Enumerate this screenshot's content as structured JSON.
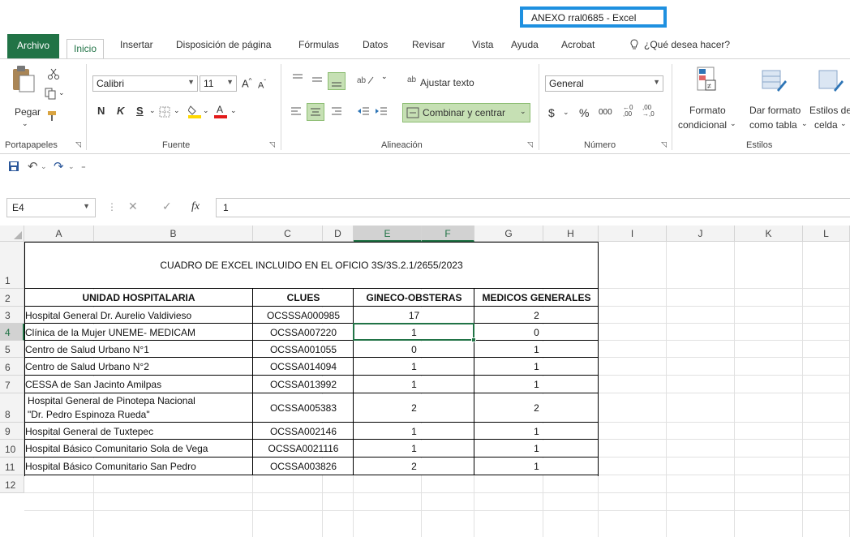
{
  "window": {
    "title": "ANEXO rral0685  -  Excel"
  },
  "tabs": [
    "Archivo",
    "Inicio",
    "Insertar",
    "Disposición de página",
    "Fórmulas",
    "Datos",
    "Revisar",
    "Vista",
    "Ayuda",
    "Acrobat"
  ],
  "tell_me": "¿Qué desea hacer?",
  "ribbon": {
    "clipboard": {
      "paste": "Pegar",
      "label": "Portapapeles"
    },
    "font": {
      "name": "Calibri",
      "size": "11",
      "bold": "N",
      "italic": "K",
      "underline": "S",
      "label": "Fuente"
    },
    "alignment": {
      "wrap": "Ajustar texto",
      "merge": "Combinar y centrar",
      "label": "Alineación"
    },
    "number": {
      "format": "General",
      "currency": "$",
      "percent": "%",
      "thousands": "000",
      "label": "Número"
    },
    "styles": {
      "conditional": [
        "Formato",
        "condicional"
      ],
      "as_table": [
        "Dar formato",
        "como tabla"
      ],
      "cell_styles": [
        "Estilos de",
        "celda"
      ],
      "label": "Estilos"
    }
  },
  "formula_bar": {
    "name_box": "E4",
    "fx": "fx",
    "value": "1"
  },
  "columns": [
    "A",
    "B",
    "C",
    "D",
    "E",
    "F",
    "G",
    "H",
    "I",
    "J",
    "K",
    "L"
  ],
  "rows": [
    "1",
    "2",
    "3",
    "4",
    "5",
    "6",
    "7",
    "8",
    "9",
    "10",
    "11",
    "12"
  ],
  "sheet": {
    "title": "CUADRO DE EXCEL INCLUIDO EN EL OFICIO 3S/3S.2.1/2655/2023",
    "headers": [
      "UNIDAD HOSPITALARIA",
      "CLUES",
      "GINECO-OBSTERAS",
      "MEDICOS GENERALES"
    ],
    "rows": [
      {
        "unidad": "Hospital General Dr. Aurelio Valdivieso",
        "clues": "OCSSSA000985",
        "gineco": "17",
        "medicos": "2"
      },
      {
        "unidad": "Clínica de la Mujer UNEME- MEDICAM",
        "clues": "OCSSA007220",
        "gineco": "1",
        "medicos": "0"
      },
      {
        "unidad": "Centro de Salud Urbano N°1",
        "clues": "OCSSA001055",
        "gineco": "0",
        "medicos": "1"
      },
      {
        "unidad": "Centro de Salud Urbano N°2",
        "clues": "OCSSA014094",
        "gineco": "1",
        "medicos": "1"
      },
      {
        "unidad": "CESSA de San Jacinto Amilpas",
        "clues": "OCSSA013992",
        "gineco": "1",
        "medicos": "1"
      },
      {
        "unidad": "Hospital General de Pinotepa Nacional",
        "unidad2": "\"Dr. Pedro Espinoza Rueda\"",
        "clues": "OCSSA005383",
        "gineco": "2",
        "medicos": "2"
      },
      {
        "unidad": "Hospital General de Tuxtepec",
        "clues": "OCSSA002146",
        "gineco": "1",
        "medicos": "1"
      },
      {
        "unidad": "Hospital Básico Comunitario Sola de Vega",
        "clues": "OCSSA0021116",
        "gineco": "1",
        "medicos": "1"
      },
      {
        "unidad": "Hospital Básico Comunitario San Pedro",
        "clues": "OCSSA003826",
        "gineco": "2",
        "medicos": "1"
      }
    ]
  },
  "colors": {
    "excel_green": "#217346",
    "title_highlight": "#1e90e0",
    "selection": "#217346"
  }
}
